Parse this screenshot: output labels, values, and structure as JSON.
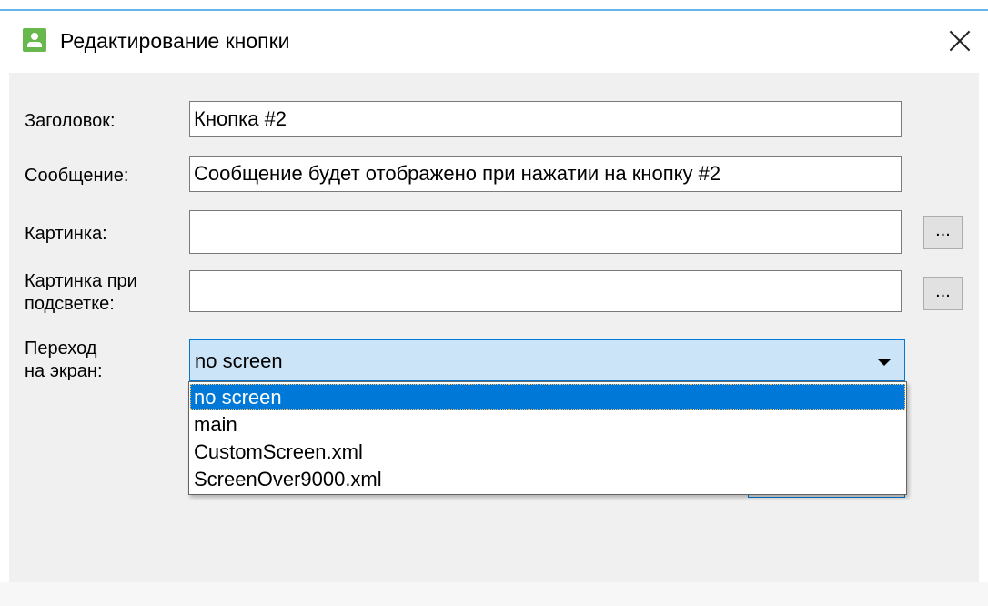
{
  "window": {
    "title": "Редактирование кнопки",
    "accent_color": "#0078d7",
    "icon": "user-app-icon",
    "close_icon": "close-icon"
  },
  "form": {
    "title_label": "Заголовок:",
    "title_value": "Кнопка #2",
    "message_label": "Сообщение:",
    "message_value": "Сообщение будет отображено при нажатии на кнопку #2",
    "image_label": "Картинка:",
    "image_value": "",
    "image_browse": "...",
    "hover_image_label_line1": "Картинка при",
    "hover_image_label_line2": "подсветке:",
    "hover_image_value": "",
    "hover_image_browse": "...",
    "screen_label_line1": "Переход",
    "screen_label_line2": "на экран:",
    "screen_selected": "no screen"
  },
  "dropdown": {
    "options": [
      "no screen",
      "main",
      "CustomScreen.xml",
      "ScreenOver9000.xml"
    ],
    "selected_index": 0
  }
}
